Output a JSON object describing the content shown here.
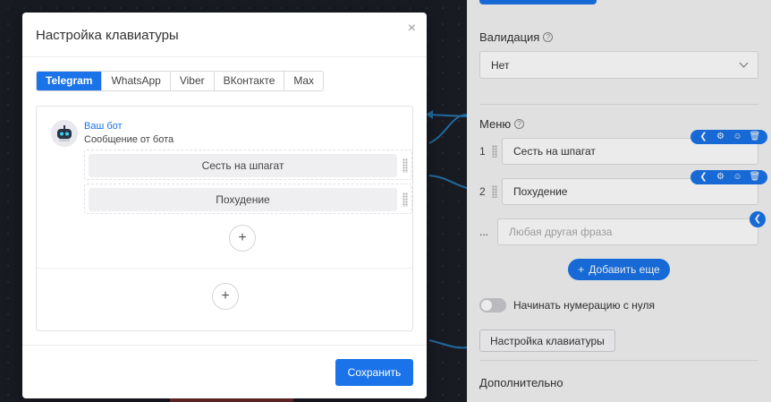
{
  "panel": {
    "validation_label": "Валидация",
    "validation_value": "Нет",
    "menu_label": "Меню",
    "menu_items": [
      {
        "num": "1",
        "text": "Сесть на шпагат"
      },
      {
        "num": "2",
        "text": "Похудение"
      }
    ],
    "menu_placeholder_num": "...",
    "menu_placeholder": "Любая другая фраза",
    "add_more": "Добавить еще",
    "toggle_label": "Начинать нумерацию с нуля",
    "keyboard_button": "Настройка клавиатуры",
    "extra_label": "Дополнительно"
  },
  "modal": {
    "title": "Настройка клавиатуры",
    "close": "×",
    "tabs": [
      "Telegram",
      "WhatsApp",
      "Viber",
      "ВКонтакте",
      "Max"
    ],
    "active_tab": 0,
    "bot_name": "Ваш бот",
    "bot_message": "Сообщение от бота",
    "keys": [
      "Сесть на шпагат",
      "Похудение"
    ],
    "add_symbol": "+",
    "save": "Сохранить"
  },
  "colors": {
    "accent": "#1a73e8",
    "canvas_bg": "#22242f",
    "panel_bg": "#f3f3f5",
    "edge_color": "#2b8fd6"
  },
  "icons": {
    "close": "close-icon",
    "help": "help-circle-icon",
    "chevron": "chevron-down-icon",
    "back": "chevron-left-icon",
    "settings": "gear-icon",
    "emoji": "smile-icon",
    "delete": "trash-icon",
    "plus": "plus-icon",
    "bot": "robot-icon"
  }
}
